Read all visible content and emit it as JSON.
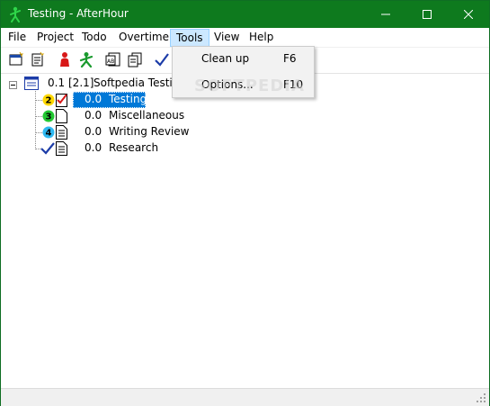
{
  "window": {
    "title": "Testing - AfterHour",
    "title_bar_color": "#0e7a1e",
    "controls": [
      "minimize",
      "maximize",
      "close"
    ]
  },
  "menubar": {
    "items": [
      {
        "label": "File"
      },
      {
        "label": "Project"
      },
      {
        "label": "Todo"
      },
      {
        "label": "Overtime"
      },
      {
        "label": "Tools",
        "active": true
      },
      {
        "label": "View"
      },
      {
        "label": "Help"
      }
    ]
  },
  "toolbar": {
    "icons": [
      "new-window-icon",
      "properties-icon",
      "red-person-icon",
      "green-person-icon",
      "abc-sort-icon",
      "copy-icon",
      "checkmark-icon"
    ]
  },
  "tools_menu": {
    "items": [
      {
        "label": "Clean up",
        "shortcut": "F6"
      },
      {
        "label": "Options...",
        "shortcut": "F10"
      }
    ]
  },
  "watermark": "SOFTPEDIA",
  "tree": {
    "root": {
      "value": "0.1",
      "total": "[2.1]",
      "label": "Softpedia Testing"
    },
    "children": [
      {
        "priority": "2",
        "priority_color": "#ffd800",
        "value": "0.0",
        "label": "Testing",
        "selected": true
      },
      {
        "priority": "3",
        "priority_color": "#22c832",
        "value": "0.0",
        "label": "Miscellaneous"
      },
      {
        "priority": "4",
        "priority_color": "#2fb8f0",
        "value": "0.0",
        "label": "Writing Review"
      },
      {
        "priority": "",
        "done": true,
        "value": "0.0",
        "label": "Research"
      }
    ]
  },
  "colors": {
    "selection": "#0078d7",
    "menu_highlight": "#cce8ff"
  }
}
